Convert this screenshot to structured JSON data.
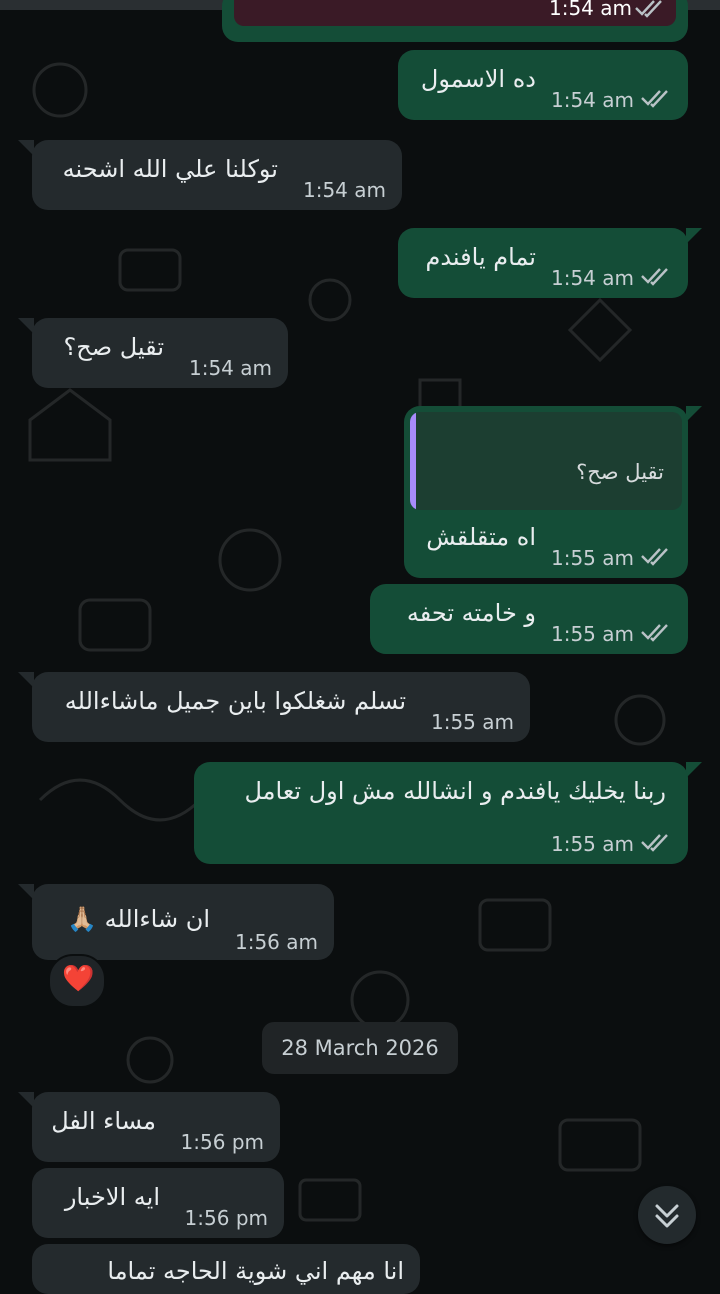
{
  "messages": [
    {
      "text": "ده الاسمول",
      "time": "1:54 am"
    },
    {
      "text": "توكلنا علي الله اشحنه",
      "time": "1:54 am"
    },
    {
      "text": "تمام يافندم",
      "time": "1:54 am"
    },
    {
      "text": "تقيل صح؟",
      "time": "1:54 am"
    },
    {
      "quote": "تقيل صح؟",
      "text": "اه متقلقش",
      "time": "1:55 am"
    },
    {
      "text": "و خامته تحفه",
      "time": "1:55 am"
    },
    {
      "text": "تسلم شغلكوا باين جميل ماشاءالله",
      "time": "1:55 am"
    },
    {
      "text": "ربنا يخليك يافندم و انشالله مش اول تعامل",
      "time": "1:55 am"
    },
    {
      "text": "ان شاءالله 🙏🏼",
      "time": "1:56 am"
    },
    {
      "text": "مساء الفل",
      "time": "1:56 pm"
    },
    {
      "text": "ايه الاخبار",
      "time": "1:56 pm"
    },
    {
      "text": "انا مهم اني شوية الحاجه تماما"
    }
  ],
  "top_clipped_time": "1:54 am",
  "reaction": "❤️",
  "date_divider": "28 March 2026",
  "icons": {
    "read": "double-check-icon",
    "scroll": "chevrons-down-icon"
  },
  "colors": {
    "outgoing": "#144d37",
    "incoming": "#242a2d",
    "quote_bar": "#a78bfa",
    "background": "#0b0e0f"
  }
}
